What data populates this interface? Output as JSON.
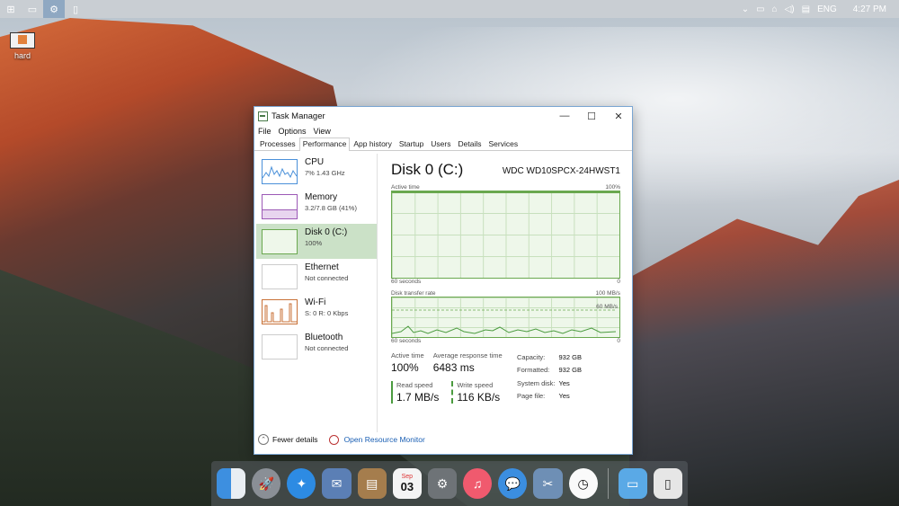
{
  "taskbar": {
    "tray": {
      "language": "ENG",
      "time": "4:27 PM"
    }
  },
  "desktop": {
    "icon_label": "hard"
  },
  "window": {
    "title": "Task Manager",
    "menu": [
      "File",
      "Options",
      "View"
    ],
    "tabs": [
      "Processes",
      "Performance",
      "App history",
      "Startup",
      "Users",
      "Details",
      "Services"
    ],
    "active_tab": "Performance"
  },
  "sidebar": {
    "items": [
      {
        "title": "CPU",
        "sub": "7%  1.43 GHz"
      },
      {
        "title": "Memory",
        "sub": "3.2/7.8 GB (41%)"
      },
      {
        "title": "Disk 0 (C:)",
        "sub": "100%"
      },
      {
        "title": "Ethernet",
        "sub": "Not connected"
      },
      {
        "title": "Wi-Fi",
        "sub": "S: 0  R: 0 Kbps"
      },
      {
        "title": "Bluetooth",
        "sub": "Not connected"
      }
    ]
  },
  "main": {
    "title": "Disk 0 (C:)",
    "model": "WDC WD10SPCX-24HWST1",
    "graph1": {
      "label_left": "Active time",
      "label_right": "100%",
      "foot_left": "60 seconds",
      "foot_right": "0"
    },
    "graph2": {
      "label_left": "Disk transfer rate",
      "label_right": "100 MB/s",
      "inner": "60 MB/s",
      "foot_left": "60 seconds",
      "foot_right": "0"
    },
    "stats": {
      "active_time_label": "Active time",
      "active_time_value": "100%",
      "response_label": "Average response time",
      "response_value": "6483 ms",
      "read_label": "Read speed",
      "read_value": "1.7 MB/s",
      "write_label": "Write speed",
      "write_value": "116 KB/s"
    },
    "props": [
      {
        "k": "Capacity:",
        "v": "932 GB"
      },
      {
        "k": "Formatted:",
        "v": "932 GB"
      },
      {
        "k": "System disk:",
        "v": "Yes"
      },
      {
        "k": "Page file:",
        "v": "Yes"
      }
    ]
  },
  "footer": {
    "fewer": "Fewer details",
    "monitor": "Open Resource Monitor"
  },
  "dock": {
    "calendar_month": "Sep",
    "calendar_day": "03"
  }
}
